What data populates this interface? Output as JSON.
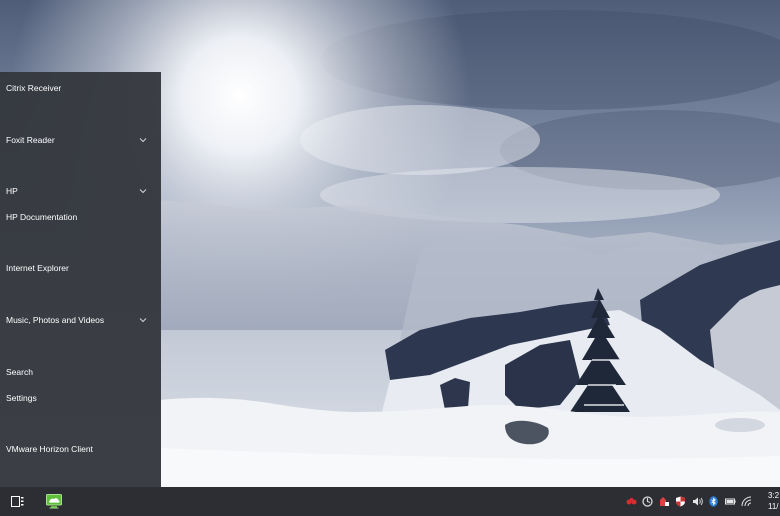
{
  "start_menu": {
    "items": [
      {
        "label": "Citrix Receiver",
        "expandable": false
      },
      {
        "label": "Foxit Reader",
        "expandable": true
      },
      {
        "label": "HP",
        "expandable": true
      },
      {
        "label": "HP Documentation",
        "expandable": false
      },
      {
        "label": "Internet Explorer",
        "expandable": false
      },
      {
        "label": "Music, Photos and Videos",
        "expandable": true
      },
      {
        "label": "Search",
        "expandable": false
      },
      {
        "label": "Settings",
        "expandable": false
      },
      {
        "label": "VMware Horizon Client",
        "expandable": false
      }
    ]
  },
  "taskbar": {
    "left_icons": [
      "task-view-icon",
      "vmware-horizon-client-icon"
    ],
    "tray_icons": [
      "antivirus-icon",
      "sync-icon",
      "security-shield-icon",
      "windows-defender-icon",
      "volume-icon",
      "bluetooth-icon",
      "battery-icon",
      "wifi-icon"
    ],
    "clock": {
      "time": "3:2",
      "date": "11/"
    }
  },
  "colors": {
    "menu_bg": "#34373d",
    "taskbar_bg": "#2c2e33",
    "text": "#ffffff",
    "accent_green": "#5fbf3a"
  }
}
